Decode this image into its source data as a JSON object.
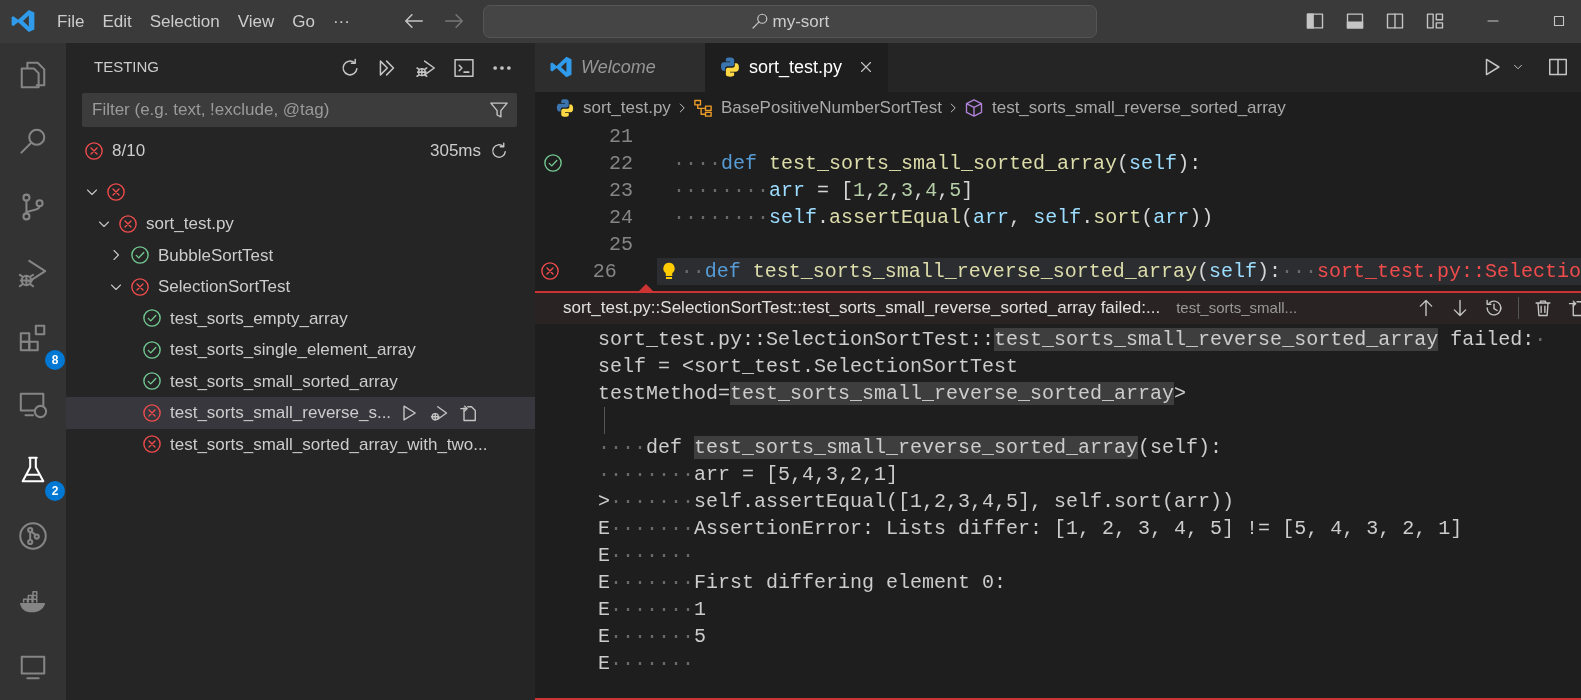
{
  "title_bar": {
    "menu": [
      {
        "label": "File"
      },
      {
        "label": "Edit"
      },
      {
        "label": "Selection"
      },
      {
        "label": "View"
      },
      {
        "label": "Go"
      },
      {
        "label": "···"
      }
    ],
    "search": {
      "value": "my-sort"
    }
  },
  "activity_bar": [
    {
      "selected": false
    },
    {
      "selected": false
    },
    {
      "selected": false
    },
    {
      "selected": false
    },
    {
      "selected": false,
      "badge": "8"
    },
    {
      "selected": false
    },
    {
      "selected": true,
      "badge": "2"
    },
    {
      "selected": false
    },
    {
      "selected": false
    },
    {
      "selected": false
    }
  ],
  "sidebar": {
    "title": "TESTING",
    "filter": {
      "placeholder": "Filter (e.g. text, !exclude, @tag)"
    },
    "summary": {
      "passed": false,
      "count": "8/10",
      "duration": "305ms"
    },
    "tree": [
      {
        "passed": false,
        "expanded": true,
        "selected": false,
        "children": [
          {
            "label": "sort_test.py",
            "passed": false,
            "expanded": true,
            "selected": false,
            "children": [
              {
                "label": "BubbleSortTest",
                "passed": true,
                "expanded": false,
                "selected": false
              },
              {
                "label": "SelectionSortTest",
                "passed": false,
                "expanded": true,
                "selected": false,
                "children": [
                  {
                    "label": "test_sorts_empty_array",
                    "passed": true,
                    "selected": false
                  },
                  {
                    "label": "test_sorts_single_element_array",
                    "passed": true,
                    "selected": false
                  },
                  {
                    "label": "test_sorts_small_sorted_array",
                    "passed": true,
                    "selected": false
                  },
                  {
                    "label": "test_sorts_small_reverse_s...",
                    "passed": false,
                    "selected": true
                  },
                  {
                    "label": "test_sorts_small_sorted_array_with_two...",
                    "passed": false,
                    "selected": false
                  }
                ]
              }
            ]
          }
        ]
      }
    ]
  },
  "editor": {
    "tabs": [
      {
        "label": "Welcome",
        "kind": "welcome",
        "preview": true,
        "selected": false
      },
      {
        "label": "sort_test.py",
        "kind": "python",
        "preview": false,
        "selected": true
      }
    ],
    "breadcrumbs": [
      {
        "label": "sort_test.py",
        "kind": "file"
      },
      {
        "label": "BasePositiveNumberSortTest",
        "kind": "class"
      },
      {
        "label": "test_sorts_small_reverse_sorted_array",
        "kind": "method"
      }
    ],
    "lines": [
      {
        "number": "21",
        "selected": false
      },
      {
        "number": "22",
        "passed": true,
        "selected": false,
        "tokens": [
          {
            "kind": "ws",
            "text": "····"
          },
          {
            "kind": "kw",
            "text": "def "
          },
          {
            "kind": "fn",
            "text": "test_sorts_small_sorted_array"
          },
          {
            "kind": "plain",
            "text": "("
          },
          {
            "kind": "var",
            "text": "self"
          },
          {
            "kind": "plain",
            "text": "):"
          }
        ]
      },
      {
        "number": "23",
        "selected": false,
        "tokens": [
          {
            "kind": "ws",
            "text": "········"
          },
          {
            "kind": "var",
            "text": "arr"
          },
          {
            "kind": "plain",
            "text": " = ["
          },
          {
            "kind": "num",
            "text": "1"
          },
          {
            "kind": "plain",
            "text": ","
          },
          {
            "kind": "num",
            "text": "2"
          },
          {
            "kind": "plain",
            "text": ","
          },
          {
            "kind": "num",
            "text": "3"
          },
          {
            "kind": "plain",
            "text": ","
          },
          {
            "kind": "num",
            "text": "4"
          },
          {
            "kind": "plain",
            "text": ","
          },
          {
            "kind": "num",
            "text": "5"
          },
          {
            "kind": "plain",
            "text": "]"
          }
        ]
      },
      {
        "number": "24",
        "selected": false,
        "tokens": [
          {
            "kind": "ws",
            "text": "········"
          },
          {
            "kind": "var",
            "text": "self"
          },
          {
            "kind": "plain",
            "text": "."
          },
          {
            "kind": "fn",
            "text": "assertEqual"
          },
          {
            "kind": "plain",
            "text": "("
          },
          {
            "kind": "var",
            "text": "arr"
          },
          {
            "kind": "plain",
            "text": ", "
          },
          {
            "kind": "var",
            "text": "self"
          },
          {
            "kind": "plain",
            "text": "."
          },
          {
            "kind": "fn",
            "text": "sort"
          },
          {
            "kind": "plain",
            "text": "("
          },
          {
            "kind": "var",
            "text": "arr"
          },
          {
            "kind": "plain",
            "text": "))"
          }
        ]
      },
      {
        "number": "25",
        "selected": false
      },
      {
        "number": "26",
        "passed": false,
        "selected": true,
        "lightbulb": true,
        "tokens": [
          {
            "kind": "ws",
            "text": "··"
          },
          {
            "kind": "kw",
            "text": "def "
          },
          {
            "kind": "fn",
            "text": "test_sorts_small_reverse_sorted_array"
          },
          {
            "kind": "plain",
            "text": "("
          },
          {
            "kind": "var",
            "text": "self"
          },
          {
            "kind": "plain",
            "text": "):"
          },
          {
            "kind": "ws",
            "text": "···"
          },
          {
            "kind": "err",
            "text": "sort_test.py::Selectio"
          }
        ]
      }
    ],
    "peek": {
      "title": "sort_test.py::SelectionSortTest::test_sorts_small_reverse_sorted_array failed:...",
      "subtitle": "test_sorts_small...",
      "lines": [
        {
          "segments": [
            {
              "kind": "text",
              "text": "sort_test.py::SelectionSortTest::"
            },
            {
              "kind": "hl",
              "text": "test_sorts_small_reverse_sorted_array"
            },
            {
              "kind": "text",
              "text": " failed:"
            },
            {
              "kind": "ws",
              "text": "·"
            }
          ]
        },
        {
          "segments": [
            {
              "kind": "text",
              "text": "self = <sort_test.SelectionSortTest"
            }
          ]
        },
        {
          "segments": [
            {
              "kind": "text",
              "text": "testMethod="
            },
            {
              "kind": "hl",
              "text": "test_sorts_small_reverse_sorted_array"
            },
            {
              "kind": "text",
              "text": ">"
            }
          ]
        },
        {
          "kind": "blank"
        },
        {
          "segments": [
            {
              "kind": "ws",
              "text": "····"
            },
            {
              "kind": "text",
              "text": "def "
            },
            {
              "kind": "hl",
              "text": "test_sorts_small_reverse_sorted_array"
            },
            {
              "kind": "text",
              "text": "(self):"
            }
          ]
        },
        {
          "segments": [
            {
              "kind": "ws",
              "text": "········"
            },
            {
              "kind": "text",
              "text": "arr = [5,4,3,2,1]"
            }
          ]
        },
        {
          "segments": [
            {
              "kind": "text",
              "text": ">"
            },
            {
              "kind": "ws",
              "text": "·······"
            },
            {
              "kind": "text",
              "text": "self.assertEqual([1,2,3,4,5], self.sort(arr))"
            }
          ]
        },
        {
          "segments": [
            {
              "kind": "text",
              "text": "E"
            },
            {
              "kind": "ws",
              "text": "·······"
            },
            {
              "kind": "text",
              "text": "AssertionError: Lists differ: [1, 2, 3, 4, 5] != [5, 4, 3, 2, 1]"
            }
          ]
        },
        {
          "segments": [
            {
              "kind": "text",
              "text": "E"
            },
            {
              "kind": "ws",
              "text": "·······"
            }
          ]
        },
        {
          "segments": [
            {
              "kind": "text",
              "text": "E"
            },
            {
              "kind": "ws",
              "text": "·······"
            },
            {
              "kind": "text",
              "text": "First differing element 0:"
            }
          ]
        },
        {
          "segments": [
            {
              "kind": "text",
              "text": "E"
            },
            {
              "kind": "ws",
              "text": "·······"
            },
            {
              "kind": "text",
              "text": "1"
            }
          ]
        },
        {
          "segments": [
            {
              "kind": "text",
              "text": "E"
            },
            {
              "kind": "ws",
              "text": "·······"
            },
            {
              "kind": "text",
              "text": "5"
            }
          ]
        },
        {
          "segments": [
            {
              "kind": "text",
              "text": "E"
            },
            {
              "kind": "ws",
              "text": "·······"
            }
          ]
        }
      ]
    }
  }
}
